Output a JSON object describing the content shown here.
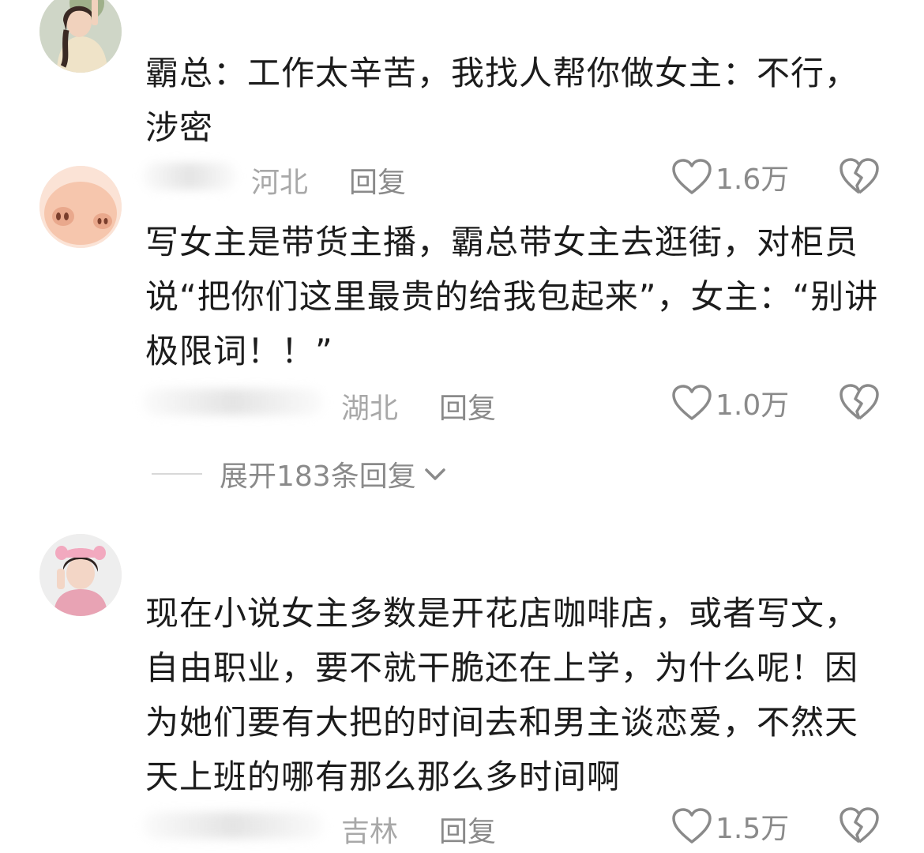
{
  "comments": [
    {
      "avatar": "girl-avatar",
      "text_lines": [
        "霸总：工作太辛苦，我找人帮你做女主：不行，",
        "涉密"
      ],
      "location": "河北",
      "reply_label": "回复",
      "likes": "1.6万",
      "like_icon": "heart-outline-icon",
      "dislike_icon": "broken-heart-icon"
    },
    {
      "avatar": "pig-avatar",
      "text_lines": [
        "写女主是带货主播，霸总带女主去逛街，对柜员",
        "说“把你们这里最贵的给我包起来”，女主：“别讲",
        "极限词！！”"
      ],
      "location": "湖北",
      "reply_label": "回复",
      "likes": "1.0万",
      "like_icon": "heart-outline-icon",
      "dislike_icon": "broken-heart-icon"
    },
    {
      "avatar": "girl-pink-hat-avatar",
      "text_lines": [
        "现在小说女主多数是开花店咖啡店，或者写文，",
        "自由职业，要不就干脆还在上学，为什么呢！因",
        "为她们要有大把的时间去和男主谈恋爱，不然天",
        "天上班的哪有那么那么多时间啊"
      ],
      "location": "吉林",
      "reply_label": "回复",
      "likes": "1.5万",
      "like_icon": "heart-outline-icon",
      "dislike_icon": "broken-heart-icon"
    }
  ],
  "expand_replies": {
    "label": "展开183条回复",
    "icon": "chevron-down-icon"
  },
  "colors": {
    "background": "#ffffff",
    "text": "#1c1c1c",
    "meta": "#8a8a8a",
    "location": "#a8a8a8"
  }
}
